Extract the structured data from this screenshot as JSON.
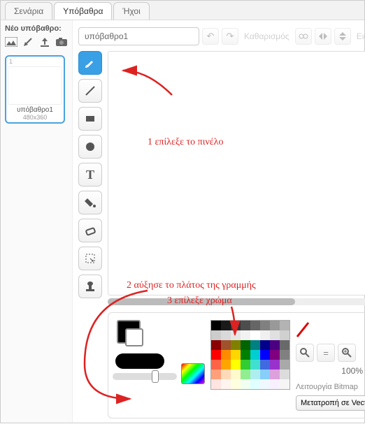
{
  "tabs": {
    "scenarios": "Σενάρια",
    "backdrops": "Υπόβαθρα",
    "sounds": "Ήχοι"
  },
  "left": {
    "header": "Νέο υπόβαθρο:",
    "thumb": {
      "num": "1",
      "name": "υπόβαθρο1",
      "dim": "480x360"
    }
  },
  "top": {
    "name_value": "υπόβαθρο1",
    "clear": "Καθαρισμός",
    "import": "Εισαγωγή"
  },
  "bottom": {
    "zoom": "100%",
    "mode": "Λειτουργία Bitmap",
    "convert": "Μετατροπή σε Vector"
  },
  "annotations": {
    "a1": "1   επίλεξε το πινέλο",
    "a2": "2   αύξησε το πλάτος της γραμμής",
    "a3": "3   επίλεξε χρώμα"
  },
  "palette_colors": [
    "#000000",
    "#1a1a1a",
    "#333333",
    "#4d4d4d",
    "#666666",
    "#808080",
    "#999999",
    "#b3b3b3",
    "#cccccc",
    "#d9d9d9",
    "#e6e6e6",
    "#f2f2f2",
    "#ffffff",
    "#f0f0f0",
    "#e0e0e0",
    "#d0d0d0",
    "#8b0000",
    "#a0522d",
    "#808000",
    "#006400",
    "#008080",
    "#00008b",
    "#4b0082",
    "#696969",
    "#ff0000",
    "#ff8c00",
    "#ffd700",
    "#008000",
    "#00ced1",
    "#0000ff",
    "#800080",
    "#808080",
    "#ff6347",
    "#ffa500",
    "#ffff00",
    "#32cd32",
    "#40e0d0",
    "#4169e1",
    "#9932cc",
    "#a9a9a9",
    "#ffa07a",
    "#ffdab9",
    "#fffacd",
    "#90ee90",
    "#afeeee",
    "#87cefa",
    "#dda0dd",
    "#dcdcdc",
    "#ffe4e1",
    "#fff5ee",
    "#ffffe0",
    "#f0fff0",
    "#e0ffff",
    "#f0f8ff",
    "#f8f0ff",
    "#f5f5f5"
  ]
}
